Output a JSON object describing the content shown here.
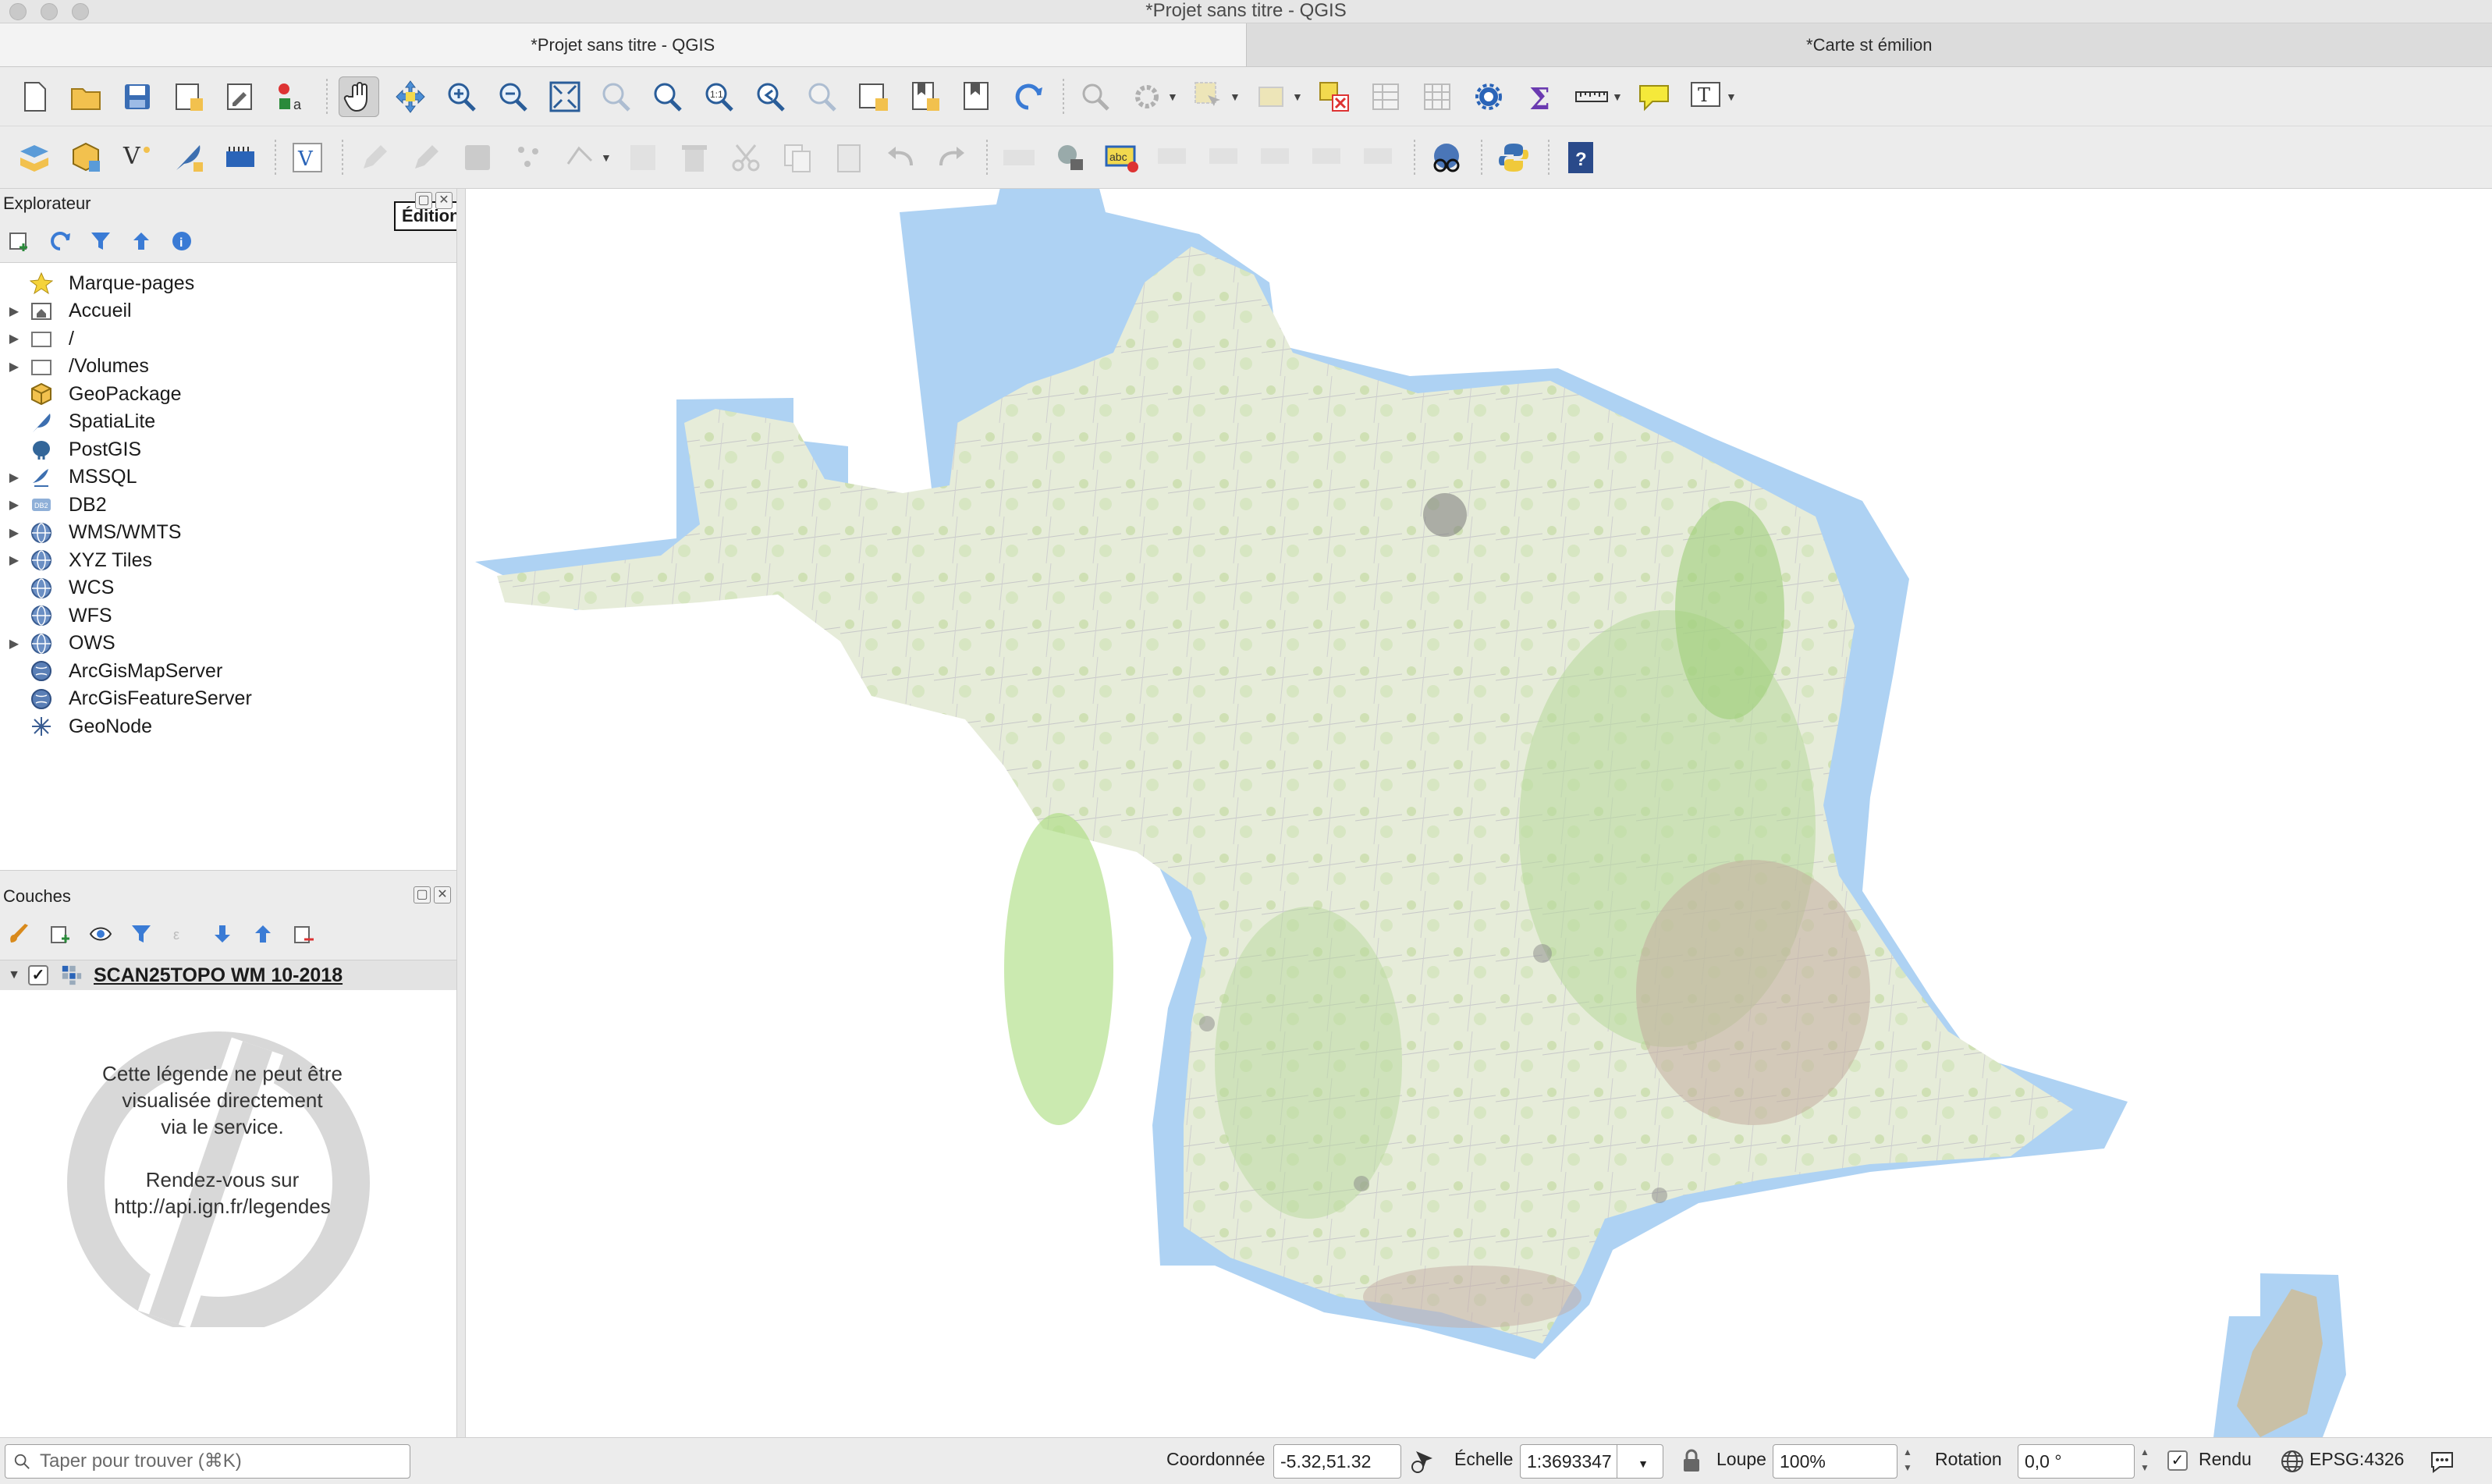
{
  "window": {
    "title": "*Projet sans titre - QGIS"
  },
  "tabs": [
    {
      "label": "*Projet sans titre - QGIS",
      "active": true
    },
    {
      "label": "*Carte st émilion",
      "active": false
    }
  ],
  "tooltip": {
    "text": "Éditions en cours"
  },
  "browser": {
    "title": "Explorateur",
    "items": [
      {
        "label": "Marque-pages",
        "icon": "star-icon",
        "expandable": false
      },
      {
        "label": "Accueil",
        "icon": "home-folder-icon",
        "expandable": true
      },
      {
        "label": "/",
        "icon": "folder-icon",
        "expandable": true
      },
      {
        "label": "/Volumes",
        "icon": "folder-icon",
        "expandable": true
      },
      {
        "label": "GeoPackage",
        "icon": "geopackage-icon",
        "expandable": false
      },
      {
        "label": "SpatiaLite",
        "icon": "spatialite-icon",
        "expandable": false
      },
      {
        "label": "PostGIS",
        "icon": "postgis-elephant-icon",
        "expandable": false
      },
      {
        "label": "MSSQL",
        "icon": "mssql-icon",
        "expandable": true
      },
      {
        "label": "DB2",
        "icon": "db2-icon",
        "expandable": true
      },
      {
        "label": "WMS/WMTS",
        "icon": "globe-icon",
        "expandable": true
      },
      {
        "label": "XYZ Tiles",
        "icon": "globe-icon",
        "expandable": true
      },
      {
        "label": "WCS",
        "icon": "globe-icon",
        "expandable": false
      },
      {
        "label": "WFS",
        "icon": "globe-icon",
        "expandable": false
      },
      {
        "label": "OWS",
        "icon": "globe-icon",
        "expandable": true
      },
      {
        "label": "ArcGisMapServer",
        "icon": "arcgis-globe-icon",
        "expandable": false
      },
      {
        "label": "ArcGisFeatureServer",
        "icon": "arcgis-globe-icon",
        "expandable": false
      },
      {
        "label": "GeoNode",
        "icon": "geonode-icon",
        "expandable": false
      }
    ]
  },
  "layers": {
    "title": "Couches",
    "items": [
      {
        "name": "SCAN25TOPO WM 10-2018",
        "checked": true,
        "checkmark": "✓"
      }
    ],
    "legend_message": "Cette légende ne peut être\nvisualisée directement\nvia le service.\n\nRendez-vous sur\nhttp://api.ign.fr/legendes"
  },
  "statusbar": {
    "search_placeholder": "Taper pour trouver (⌘K)",
    "coord_label": "Coordonnée",
    "coord_value": "-5.32,51.32",
    "scale_label": "Échelle",
    "scale_value": "1:3693347",
    "magnifier_label": "Loupe",
    "magnifier_value": "100%",
    "rotation_label": "Rotation",
    "rotation_value": "0,0 °",
    "render_label": "Rendu",
    "render_checked": true,
    "render_checkmark": "✓",
    "crs_label": "EPSG:4326"
  },
  "colors": {
    "map_land": "#e3ebd5",
    "map_sea": "#a9cff2",
    "forest": "#9ed27a",
    "mountain": "#b9a7a4",
    "urban": "#6b6b6b"
  }
}
